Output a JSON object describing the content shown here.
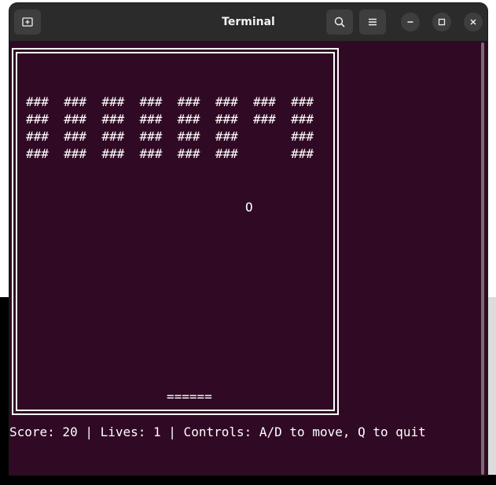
{
  "window": {
    "title": "Terminal"
  },
  "icons": {
    "new_tab": "new-tab-icon",
    "search": "search-icon",
    "menu": "hamburger-menu-icon",
    "minimize": "minimize-icon",
    "maximize": "maximize-icon",
    "close": "close-icon"
  },
  "colors": {
    "terminal_bg": "#300a24",
    "titlebar_bg": "#2b2b2b",
    "text": "#ffffff"
  },
  "game": {
    "bricks": [
      "###  ###  ###  ###  ###  ###  ###  ###",
      "###  ###  ###  ###  ###  ###  ###  ###",
      "###  ###  ###  ###  ###  ###       ###",
      "###  ###  ###  ###  ###  ###       ###"
    ],
    "ball": "O",
    "paddle": "======"
  },
  "status": "Score: 20 | Lives: 1 | Controls: A/D to move, Q to quit"
}
